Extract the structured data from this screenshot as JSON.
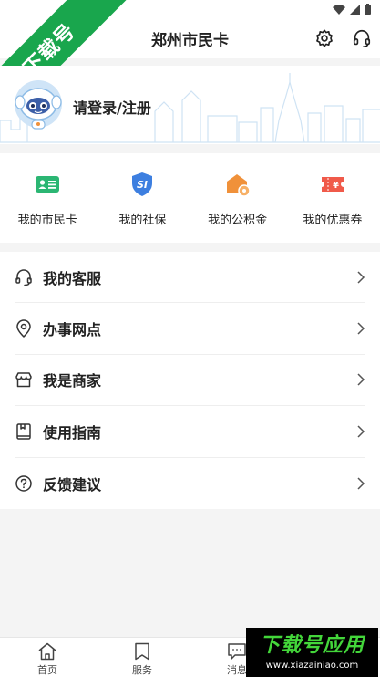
{
  "header": {
    "title": "郑州市民卡"
  },
  "corner_badge": {
    "text": "下载号"
  },
  "login": {
    "text": "请登录/注册"
  },
  "services": [
    {
      "label": "我的市民卡",
      "icon": "citizen-card-icon",
      "color": "#2bb673"
    },
    {
      "label": "我的社保",
      "icon": "social-security-shield-icon",
      "color": "#3d7fe0"
    },
    {
      "label": "我的公积金",
      "icon": "housing-fund-icon",
      "color": "#f0913a"
    },
    {
      "label": "我的优惠券",
      "icon": "coupon-ticket-icon",
      "color": "#f05a4a"
    }
  ],
  "menu": [
    {
      "label": "我的客服",
      "icon": "headset-icon"
    },
    {
      "label": "办事网点",
      "icon": "location-pin-icon"
    },
    {
      "label": "我是商家",
      "icon": "store-icon"
    },
    {
      "label": "使用指南",
      "icon": "guide-book-icon"
    },
    {
      "label": "反馈建议",
      "icon": "question-circle-icon"
    }
  ],
  "tabbar": [
    {
      "label": "首页",
      "icon": "home-icon"
    },
    {
      "label": "服务",
      "icon": "bookmark-icon"
    },
    {
      "label": "消息",
      "icon": "message-icon"
    }
  ],
  "watermark": {
    "title": "下载号应用",
    "url": "www.xiazainiao.com"
  }
}
